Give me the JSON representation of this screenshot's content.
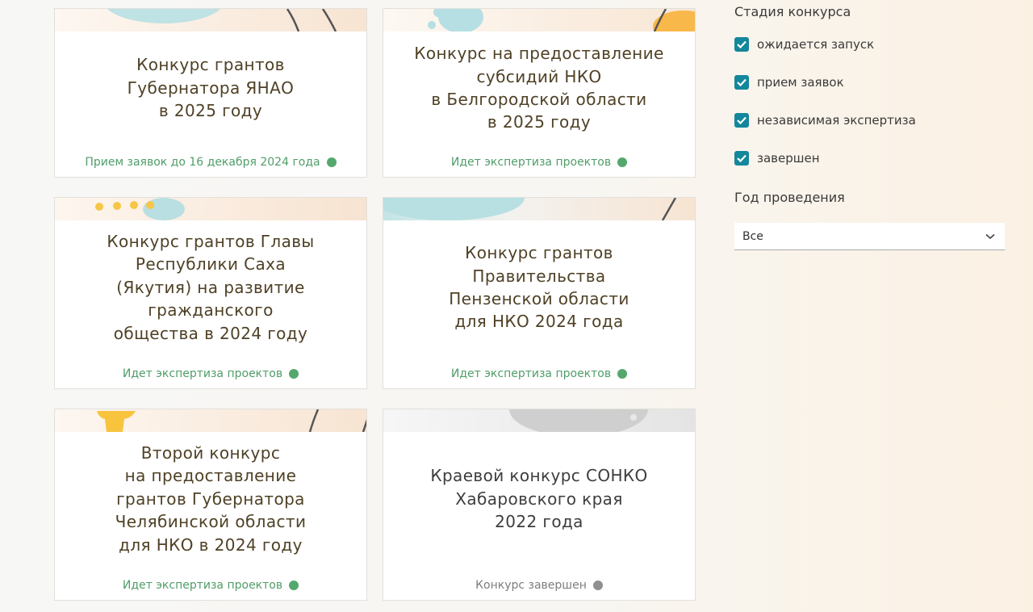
{
  "cards": [
    {
      "title": "Конкурс грантов\nГубернатора ЯНАО\nв 2025 году",
      "status": "Прием заявок до 16 декабря 2024 года"
    },
    {
      "title": "Конкурс на предоставление\nсубсидий НКО\nв Белгородской области\nв 2025 году",
      "status": "Идет экспертиза проектов"
    },
    {
      "title": "Конкурс грантов Главы\nРеспублики Саха\n(Якутия) на развитие\nгражданского\nобщества в 2024 году",
      "status": "Идет экспертиза проектов"
    },
    {
      "title": "Конкурс грантов\nПравительства\nПензенской области\nдля НКО 2024 года",
      "status": "Идет экспертиза проектов"
    },
    {
      "title": "Второй конкурс\nна предоставление\nгрантов Губернатора\nЧелябинской области\nдля НКО в 2024 году",
      "status": "Идет экспертиза проектов"
    },
    {
      "title": "Краевой конкурс СОНКО\nХабаровского края\n2022 года",
      "status": "Конкурс завершен"
    }
  ],
  "filters": {
    "stage_title": "Стадия конкурса",
    "stages": [
      {
        "label": "ожидается запуск",
        "checked": true
      },
      {
        "label": "прием заявок",
        "checked": true
      },
      {
        "label": "независимая экспертиза",
        "checked": true
      },
      {
        "label": "завершен",
        "checked": true
      }
    ],
    "year_title": "Год проведения",
    "year_value": "Все"
  },
  "colors": {
    "status_active": "#55a86d",
    "status_finished": "#8f8f8f",
    "checkbox": "#13879b",
    "title_text": "#4f4126"
  }
}
